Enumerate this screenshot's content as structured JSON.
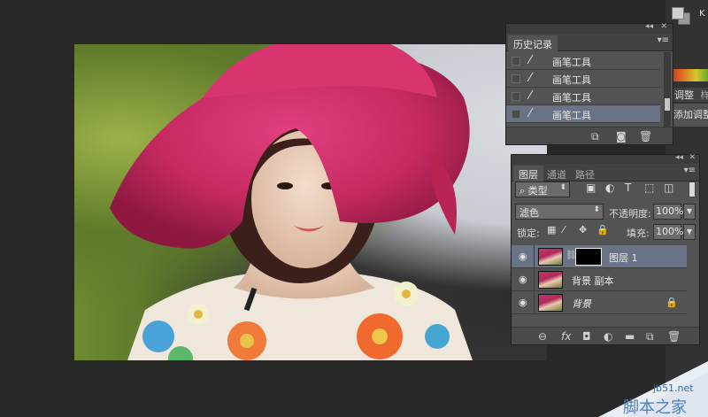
{
  "color_panel": {
    "k_label": "K"
  },
  "side_tabs": {
    "adjust": "调整",
    "second": "样",
    "add_adjust": "添加调整"
  },
  "history_panel": {
    "tab": "历史记录",
    "items": [
      {
        "label": "画笔工具",
        "selected": false
      },
      {
        "label": "画笔工具",
        "selected": false
      },
      {
        "label": "画笔工具",
        "selected": false
      },
      {
        "label": "画笔工具",
        "selected": true
      }
    ]
  },
  "layers_panel": {
    "tabs": [
      "图层",
      "通道",
      "路径"
    ],
    "filter_kind": "类型",
    "blend_mode": "滤色",
    "opacity_label": "不透明度:",
    "opacity_value": "100%",
    "lock_label": "锁定:",
    "fill_label": "填充:",
    "fill_value": "100%",
    "layers": [
      {
        "name": "图层 1",
        "selected": true,
        "has_mask": true,
        "locked": false
      },
      {
        "name": "背景 副本",
        "selected": false,
        "has_mask": false,
        "locked": false
      },
      {
        "name": "背景",
        "selected": false,
        "has_mask": false,
        "locked": true
      }
    ]
  },
  "watermark": {
    "url": "jb51.net",
    "text": "脚本之家"
  }
}
